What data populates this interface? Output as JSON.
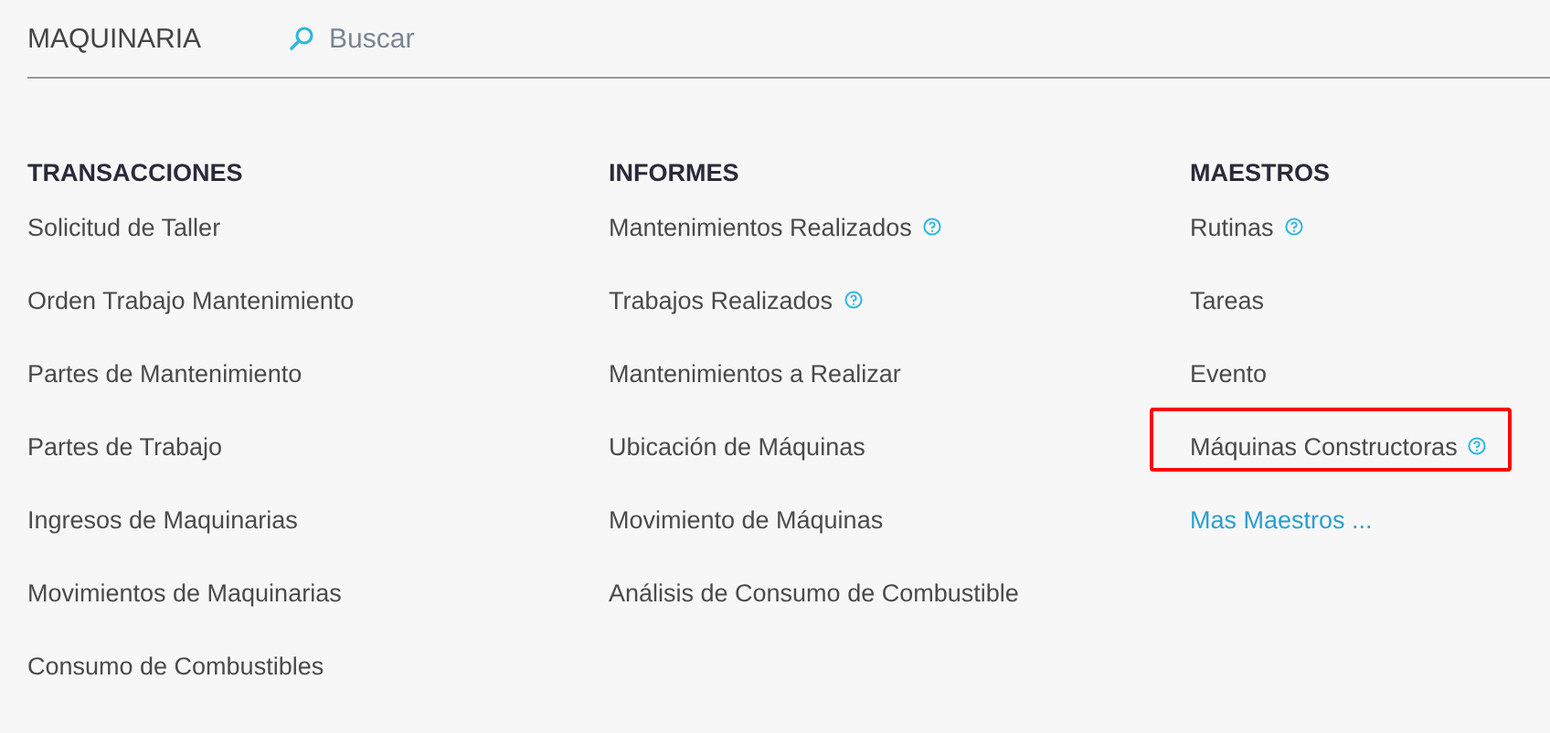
{
  "header": {
    "title": "MAQUINARIA",
    "search": {
      "placeholder": "Buscar"
    }
  },
  "columns": [
    {
      "heading": "TRANSACCIONES",
      "items": [
        {
          "label": "Solicitud de Taller",
          "help": false,
          "highlighted": false,
          "kind": "link"
        },
        {
          "label": "Orden Trabajo Mantenimiento",
          "help": false,
          "highlighted": false,
          "kind": "link"
        },
        {
          "label": "Partes de Mantenimiento",
          "help": false,
          "highlighted": false,
          "kind": "link"
        },
        {
          "label": "Partes de Trabajo",
          "help": false,
          "highlighted": false,
          "kind": "link"
        },
        {
          "label": "Ingresos de Maquinarias",
          "help": false,
          "highlighted": false,
          "kind": "link"
        },
        {
          "label": "Movimientos de Maquinarias",
          "help": false,
          "highlighted": false,
          "kind": "link"
        },
        {
          "label": "Consumo de Combustibles",
          "help": false,
          "highlighted": false,
          "kind": "link"
        }
      ]
    },
    {
      "heading": "INFORMES",
      "items": [
        {
          "label": "Mantenimientos Realizados",
          "help": true,
          "highlighted": false,
          "kind": "link"
        },
        {
          "label": "Trabajos Realizados",
          "help": true,
          "highlighted": false,
          "kind": "link"
        },
        {
          "label": "Mantenimientos a Realizar",
          "help": false,
          "highlighted": false,
          "kind": "link"
        },
        {
          "label": "Ubicación de Máquinas",
          "help": false,
          "highlighted": false,
          "kind": "link"
        },
        {
          "label": "Movimiento de Máquinas",
          "help": false,
          "highlighted": false,
          "kind": "link"
        },
        {
          "label": "Análisis de Consumo de Combustible",
          "help": false,
          "highlighted": false,
          "kind": "link"
        }
      ]
    },
    {
      "heading": "MAESTROS",
      "items": [
        {
          "label": "Rutinas",
          "help": true,
          "highlighted": false,
          "kind": "link"
        },
        {
          "label": "Tareas",
          "help": false,
          "highlighted": false,
          "kind": "link"
        },
        {
          "label": "Evento",
          "help": false,
          "highlighted": false,
          "kind": "link"
        },
        {
          "label": "Máquinas Constructoras",
          "help": true,
          "highlighted": true,
          "kind": "link"
        },
        {
          "label": "Mas Maestros ...",
          "help": false,
          "highlighted": false,
          "kind": "more"
        }
      ]
    }
  ]
}
